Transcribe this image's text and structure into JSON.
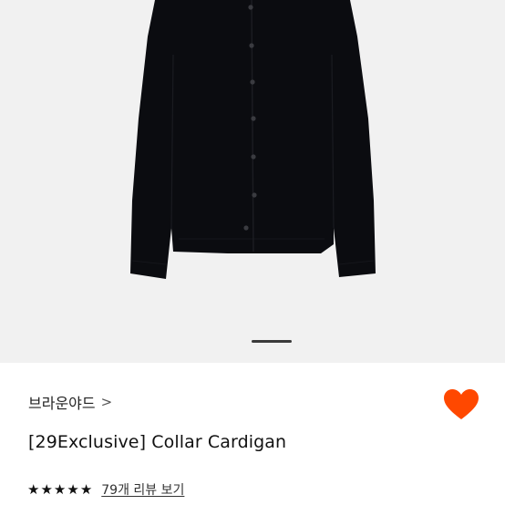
{
  "product": {
    "image_alt": "Black collar cardigan product photo",
    "brand": "브라운야드",
    "brand_chevron": ">",
    "title": "[29Exclusive] Collar Cardigan",
    "rating": {
      "stars": 5,
      "star_glyph": "★",
      "review_link": "79개 리뷰 보기"
    },
    "wishlist_icon": "heart-icon",
    "wishlist_color": "#ff4800"
  },
  "gallery": {
    "indicator": "page-indicator"
  },
  "colors": {
    "image_background": "#f1f1f1",
    "garment": "#0b0c10",
    "accent": "#ff4800"
  }
}
